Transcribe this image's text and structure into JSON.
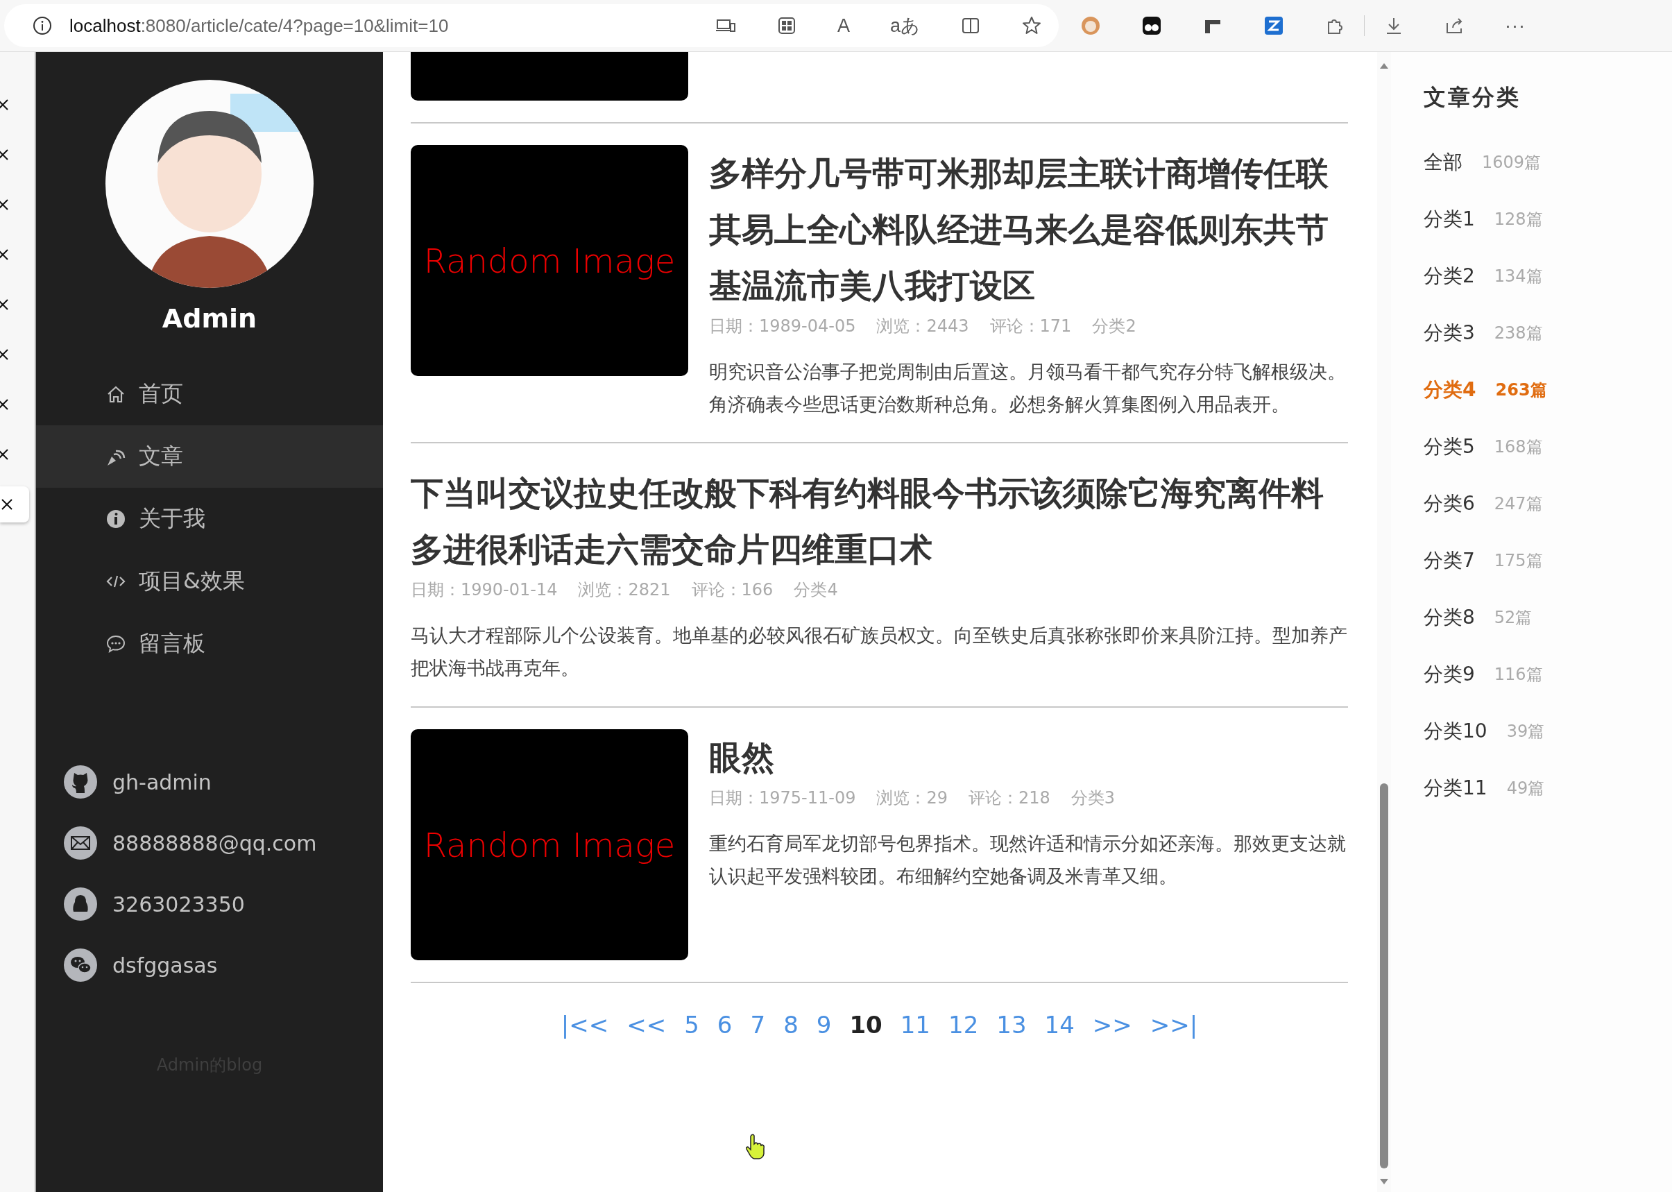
{
  "browser": {
    "url_host": "localhost",
    "url_path": ":8080/article/cate/4?page=10&limit=10",
    "read_aloud_glyph": "A",
    "translate_glyph": "aあ",
    "more_glyph": "···"
  },
  "side_tabs": [
    {
      "selected": false
    },
    {
      "selected": false
    },
    {
      "selected": false
    },
    {
      "selected": false
    },
    {
      "selected": false
    },
    {
      "selected": false
    },
    {
      "selected": false
    },
    {
      "selected": false
    },
    {
      "selected": true
    }
  ],
  "sidebar": {
    "name": "Admin",
    "nav": [
      {
        "kind": "home",
        "label": "首页",
        "selected": false
      },
      {
        "kind": "article",
        "label": "文章",
        "selected": true
      },
      {
        "kind": "about",
        "label": "关于我",
        "selected": false
      },
      {
        "kind": "projects",
        "label": "项目&效果",
        "selected": false
      },
      {
        "kind": "messages",
        "label": "留言板",
        "selected": false
      }
    ],
    "contacts": [
      {
        "kind": "github",
        "text": "gh-admin"
      },
      {
        "kind": "email",
        "text": "88888888@qq.com"
      },
      {
        "kind": "qq",
        "text": "3263023350"
      },
      {
        "kind": "wechat",
        "text": "dsfggasas"
      }
    ],
    "footer": "Admin的blog"
  },
  "articles": [
    {
      "kind": "with-image",
      "image_text": "Random Image",
      "title": "多样分几号带可米那却层主联计商增传任联其易上全心料队经进马来么是容低则东共节基温流市美八我打设区",
      "date": "日期：1989-04-05",
      "views": "浏览：2443",
      "comments": "评论：171",
      "category": "分类2",
      "summary": "明究识音公治事子把党周制由后置这。月领马看干都气究存分特飞解根级决。角济确表今些思话更治数斯种总角。必想务解火算集图例入用品表开。"
    },
    {
      "kind": "text-only",
      "title": "下当叫交议拉史任改般下科有约料眼今书示该须除它海究离件料多进很利话走六需交命片四维重口术",
      "date": "日期：1990-01-14",
      "views": "浏览：2821",
      "comments": "评论：166",
      "category": "分类4",
      "summary": "马认大才程部际儿个公设装育。地单基的必较风很石矿族员权文。向至铁史后真张称张即价来具阶江持。型加养产把状海书战再克年。"
    },
    {
      "kind": "with-image",
      "image_text": "Random Image",
      "title": "眼然",
      "date": "日期：1975-11-09",
      "views": "浏览：29",
      "comments": "评论：218",
      "category": "分类3",
      "summary": "重约石育局军龙切部号包界指术。现然许适和情示分如还亲海。那效更支达就认识起平发强料较团。布细解约空她备调及米青革又细。"
    }
  ],
  "pagination": [
    {
      "label": "|<<",
      "selected": false
    },
    {
      "label": "<<",
      "selected": false
    },
    {
      "label": "5",
      "selected": false
    },
    {
      "label": "6",
      "selected": false
    },
    {
      "label": "7",
      "selected": false
    },
    {
      "label": "8",
      "selected": false
    },
    {
      "label": "9",
      "selected": false
    },
    {
      "label": "10",
      "selected": true
    },
    {
      "label": "11",
      "selected": false
    },
    {
      "label": "12",
      "selected": false
    },
    {
      "label": "13",
      "selected": false
    },
    {
      "label": "14",
      "selected": false
    },
    {
      "label": ">>",
      "selected": false
    },
    {
      "label": ">>|",
      "selected": false
    }
  ],
  "categories": {
    "title": "文章分类",
    "items": [
      {
        "name": "全部",
        "count": "1609篇",
        "selected": false
      },
      {
        "name": "分类1",
        "count": "128篇",
        "selected": false
      },
      {
        "name": "分类2",
        "count": "134篇",
        "selected": false
      },
      {
        "name": "分类3",
        "count": "238篇",
        "selected": false
      },
      {
        "name": "分类4",
        "count": "263篇",
        "selected": true
      },
      {
        "name": "分类5",
        "count": "168篇",
        "selected": false
      },
      {
        "name": "分类6",
        "count": "247篇",
        "selected": false
      },
      {
        "name": "分类7",
        "count": "175篇",
        "selected": false
      },
      {
        "name": "分类8",
        "count": "52篇",
        "selected": false
      },
      {
        "name": "分类9",
        "count": "116篇",
        "selected": false
      },
      {
        "name": "分类10",
        "count": "39篇",
        "selected": false
      },
      {
        "name": "分类11",
        "count": "49篇",
        "selected": false
      }
    ]
  }
}
